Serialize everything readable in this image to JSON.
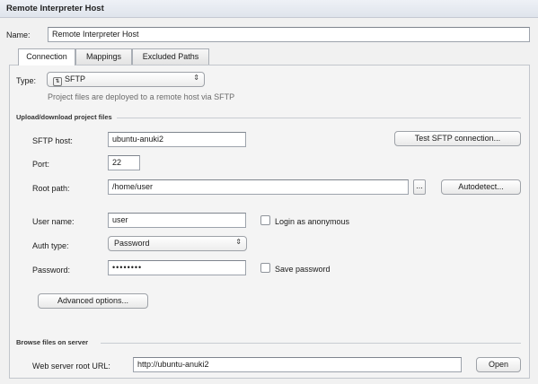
{
  "window": {
    "title": "Remote Interpreter Host"
  },
  "name_row": {
    "label": "Name:",
    "value": "Remote Interpreter Host"
  },
  "tabs": [
    {
      "label": "Connection",
      "active": true
    },
    {
      "label": "Mappings",
      "active": false
    },
    {
      "label": "Excluded Paths",
      "active": false
    }
  ],
  "type_row": {
    "label": "Type:",
    "selected": "SFTP",
    "icon": "sftp-icon",
    "hint": "Project files are deployed to a remote host via SFTP"
  },
  "upload": {
    "section_title": "Upload/download project files",
    "sftp_host": {
      "label": "SFTP host:",
      "value": "ubuntu-anuki2"
    },
    "test_button": "Test SFTP connection...",
    "port": {
      "label": "Port:",
      "value": "22"
    },
    "root_path": {
      "label": "Root path:",
      "value": "/home/user",
      "browse": "..."
    },
    "autodetect_button": "Autodetect...",
    "user_name": {
      "label": "User name:",
      "value": "user"
    },
    "login_anonymous": {
      "label": "Login as anonymous",
      "checked": false
    },
    "auth_type": {
      "label": "Auth type:",
      "value": "Password"
    },
    "password": {
      "label": "Password:",
      "value": "••••••••"
    },
    "save_password": {
      "label": "Save password",
      "checked": false
    },
    "advanced_button": "Advanced options..."
  },
  "browse": {
    "section_title": "Browse files on server",
    "web_root": {
      "label": "Web server root URL:",
      "value": "http://ubuntu-anuki2"
    },
    "open_button": "Open"
  },
  "colors": {
    "accent": "#dfe4ec",
    "panel": "#f4f4f4",
    "border": "#9da3ac"
  }
}
